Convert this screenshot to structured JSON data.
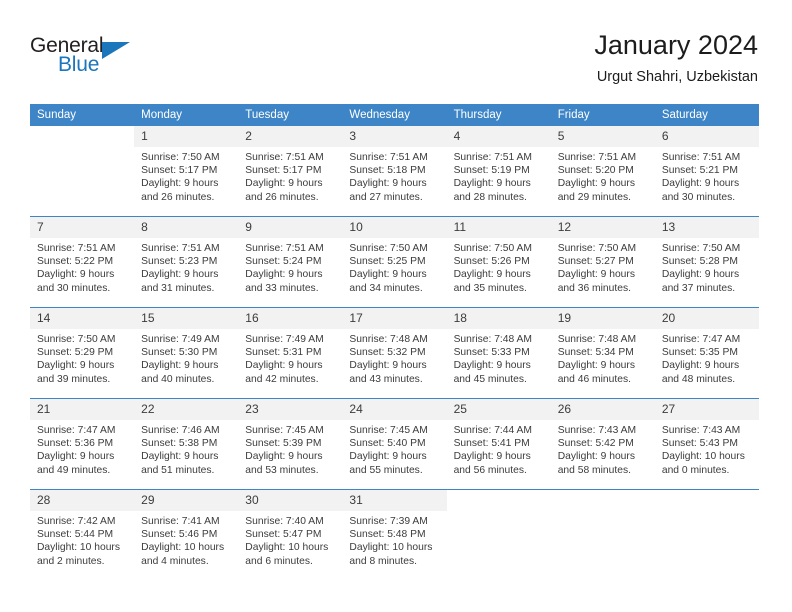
{
  "brand": {
    "name_part1": "General",
    "name_part2": "Blue",
    "accent_color": "#1b76bc"
  },
  "header": {
    "title": "January 2024",
    "subtitle": "Urgut Shahri, Uzbekistan"
  },
  "calendar": {
    "header_bg": "#3d85c6",
    "daynum_bg": "#f2f2f2",
    "weekday_headers": [
      "Sunday",
      "Monday",
      "Tuesday",
      "Wednesday",
      "Thursday",
      "Friday",
      "Saturday"
    ],
    "weeks": [
      [
        {
          "day": "",
          "sunrise": "",
          "sunset": "",
          "daylight1": "",
          "daylight2": ""
        },
        {
          "day": "1",
          "sunrise": "Sunrise: 7:50 AM",
          "sunset": "Sunset: 5:17 PM",
          "daylight1": "Daylight: 9 hours",
          "daylight2": "and 26 minutes."
        },
        {
          "day": "2",
          "sunrise": "Sunrise: 7:51 AM",
          "sunset": "Sunset: 5:17 PM",
          "daylight1": "Daylight: 9 hours",
          "daylight2": "and 26 minutes."
        },
        {
          "day": "3",
          "sunrise": "Sunrise: 7:51 AM",
          "sunset": "Sunset: 5:18 PM",
          "daylight1": "Daylight: 9 hours",
          "daylight2": "and 27 minutes."
        },
        {
          "day": "4",
          "sunrise": "Sunrise: 7:51 AM",
          "sunset": "Sunset: 5:19 PM",
          "daylight1": "Daylight: 9 hours",
          "daylight2": "and 28 minutes."
        },
        {
          "day": "5",
          "sunrise": "Sunrise: 7:51 AM",
          "sunset": "Sunset: 5:20 PM",
          "daylight1": "Daylight: 9 hours",
          "daylight2": "and 29 minutes."
        },
        {
          "day": "6",
          "sunrise": "Sunrise: 7:51 AM",
          "sunset": "Sunset: 5:21 PM",
          "daylight1": "Daylight: 9 hours",
          "daylight2": "and 30 minutes."
        }
      ],
      [
        {
          "day": "7",
          "sunrise": "Sunrise: 7:51 AM",
          "sunset": "Sunset: 5:22 PM",
          "daylight1": "Daylight: 9 hours",
          "daylight2": "and 30 minutes."
        },
        {
          "day": "8",
          "sunrise": "Sunrise: 7:51 AM",
          "sunset": "Sunset: 5:23 PM",
          "daylight1": "Daylight: 9 hours",
          "daylight2": "and 31 minutes."
        },
        {
          "day": "9",
          "sunrise": "Sunrise: 7:51 AM",
          "sunset": "Sunset: 5:24 PM",
          "daylight1": "Daylight: 9 hours",
          "daylight2": "and 33 minutes."
        },
        {
          "day": "10",
          "sunrise": "Sunrise: 7:50 AM",
          "sunset": "Sunset: 5:25 PM",
          "daylight1": "Daylight: 9 hours",
          "daylight2": "and 34 minutes."
        },
        {
          "day": "11",
          "sunrise": "Sunrise: 7:50 AM",
          "sunset": "Sunset: 5:26 PM",
          "daylight1": "Daylight: 9 hours",
          "daylight2": "and 35 minutes."
        },
        {
          "day": "12",
          "sunrise": "Sunrise: 7:50 AM",
          "sunset": "Sunset: 5:27 PM",
          "daylight1": "Daylight: 9 hours",
          "daylight2": "and 36 minutes."
        },
        {
          "day": "13",
          "sunrise": "Sunrise: 7:50 AM",
          "sunset": "Sunset: 5:28 PM",
          "daylight1": "Daylight: 9 hours",
          "daylight2": "and 37 minutes."
        }
      ],
      [
        {
          "day": "14",
          "sunrise": "Sunrise: 7:50 AM",
          "sunset": "Sunset: 5:29 PM",
          "daylight1": "Daylight: 9 hours",
          "daylight2": "and 39 minutes."
        },
        {
          "day": "15",
          "sunrise": "Sunrise: 7:49 AM",
          "sunset": "Sunset: 5:30 PM",
          "daylight1": "Daylight: 9 hours",
          "daylight2": "and 40 minutes."
        },
        {
          "day": "16",
          "sunrise": "Sunrise: 7:49 AM",
          "sunset": "Sunset: 5:31 PM",
          "daylight1": "Daylight: 9 hours",
          "daylight2": "and 42 minutes."
        },
        {
          "day": "17",
          "sunrise": "Sunrise: 7:48 AM",
          "sunset": "Sunset: 5:32 PM",
          "daylight1": "Daylight: 9 hours",
          "daylight2": "and 43 minutes."
        },
        {
          "day": "18",
          "sunrise": "Sunrise: 7:48 AM",
          "sunset": "Sunset: 5:33 PM",
          "daylight1": "Daylight: 9 hours",
          "daylight2": "and 45 minutes."
        },
        {
          "day": "19",
          "sunrise": "Sunrise: 7:48 AM",
          "sunset": "Sunset: 5:34 PM",
          "daylight1": "Daylight: 9 hours",
          "daylight2": "and 46 minutes."
        },
        {
          "day": "20",
          "sunrise": "Sunrise: 7:47 AM",
          "sunset": "Sunset: 5:35 PM",
          "daylight1": "Daylight: 9 hours",
          "daylight2": "and 48 minutes."
        }
      ],
      [
        {
          "day": "21",
          "sunrise": "Sunrise: 7:47 AM",
          "sunset": "Sunset: 5:36 PM",
          "daylight1": "Daylight: 9 hours",
          "daylight2": "and 49 minutes."
        },
        {
          "day": "22",
          "sunrise": "Sunrise: 7:46 AM",
          "sunset": "Sunset: 5:38 PM",
          "daylight1": "Daylight: 9 hours",
          "daylight2": "and 51 minutes."
        },
        {
          "day": "23",
          "sunrise": "Sunrise: 7:45 AM",
          "sunset": "Sunset: 5:39 PM",
          "daylight1": "Daylight: 9 hours",
          "daylight2": "and 53 minutes."
        },
        {
          "day": "24",
          "sunrise": "Sunrise: 7:45 AM",
          "sunset": "Sunset: 5:40 PM",
          "daylight1": "Daylight: 9 hours",
          "daylight2": "and 55 minutes."
        },
        {
          "day": "25",
          "sunrise": "Sunrise: 7:44 AM",
          "sunset": "Sunset: 5:41 PM",
          "daylight1": "Daylight: 9 hours",
          "daylight2": "and 56 minutes."
        },
        {
          "day": "26",
          "sunrise": "Sunrise: 7:43 AM",
          "sunset": "Sunset: 5:42 PM",
          "daylight1": "Daylight: 9 hours",
          "daylight2": "and 58 minutes."
        },
        {
          "day": "27",
          "sunrise": "Sunrise: 7:43 AM",
          "sunset": "Sunset: 5:43 PM",
          "daylight1": "Daylight: 10 hours",
          "daylight2": "and 0 minutes."
        }
      ],
      [
        {
          "day": "28",
          "sunrise": "Sunrise: 7:42 AM",
          "sunset": "Sunset: 5:44 PM",
          "daylight1": "Daylight: 10 hours",
          "daylight2": "and 2 minutes."
        },
        {
          "day": "29",
          "sunrise": "Sunrise: 7:41 AM",
          "sunset": "Sunset: 5:46 PM",
          "daylight1": "Daylight: 10 hours",
          "daylight2": "and 4 minutes."
        },
        {
          "day": "30",
          "sunrise": "Sunrise: 7:40 AM",
          "sunset": "Sunset: 5:47 PM",
          "daylight1": "Daylight: 10 hours",
          "daylight2": "and 6 minutes."
        },
        {
          "day": "31",
          "sunrise": "Sunrise: 7:39 AM",
          "sunset": "Sunset: 5:48 PM",
          "daylight1": "Daylight: 10 hours",
          "daylight2": "and 8 minutes."
        },
        {
          "day": "",
          "sunrise": "",
          "sunset": "",
          "daylight1": "",
          "daylight2": ""
        },
        {
          "day": "",
          "sunrise": "",
          "sunset": "",
          "daylight1": "",
          "daylight2": ""
        },
        {
          "day": "",
          "sunrise": "",
          "sunset": "",
          "daylight1": "",
          "daylight2": ""
        }
      ]
    ]
  }
}
